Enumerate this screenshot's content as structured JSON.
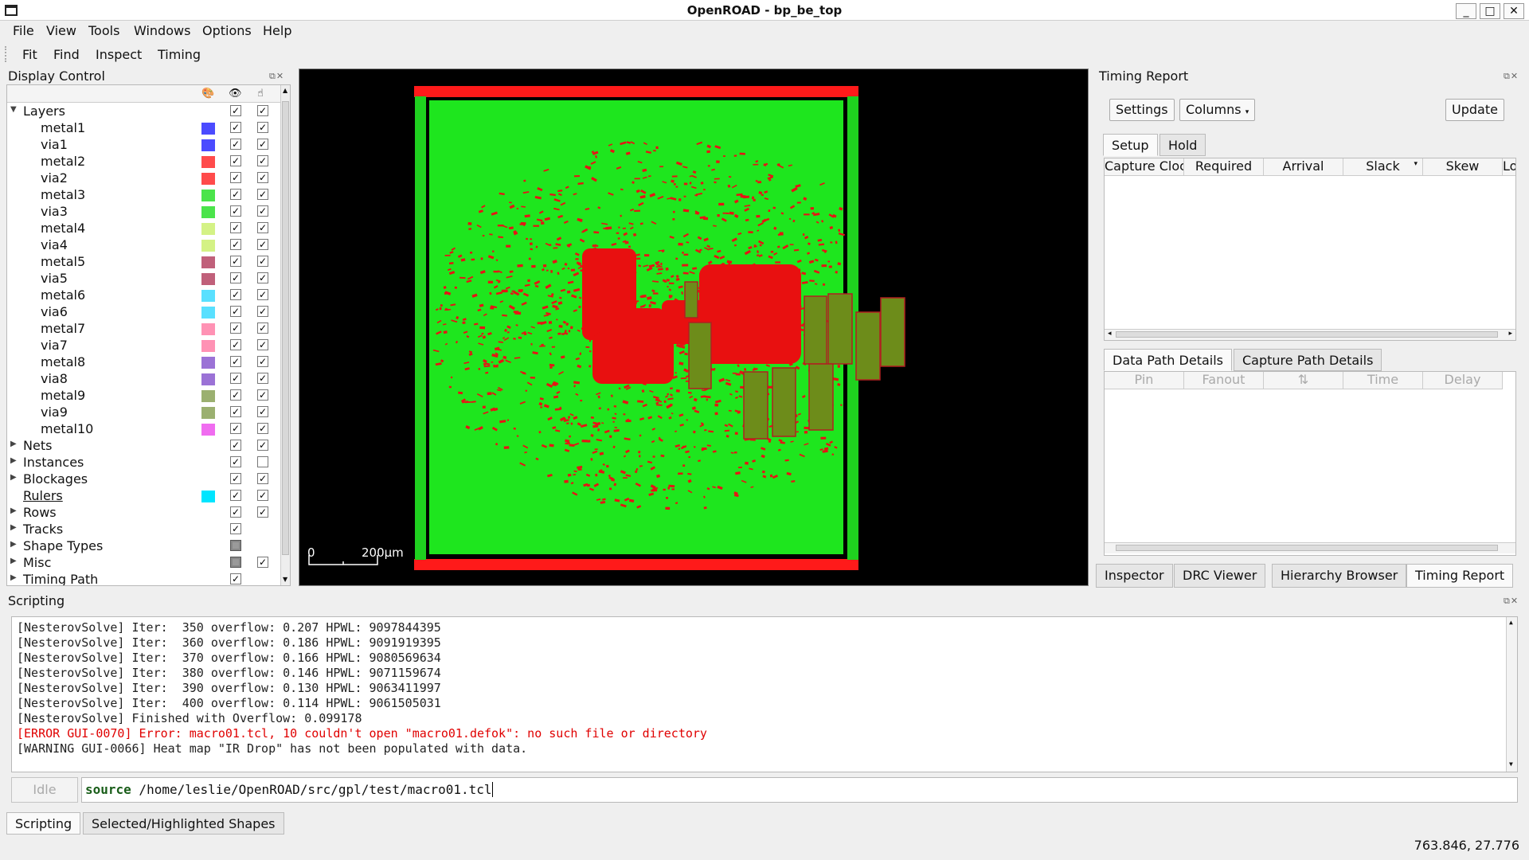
{
  "window": {
    "title": "OpenROAD - bp_be_top"
  },
  "menu": [
    "File",
    "View",
    "Tools",
    "Windows",
    "Options",
    "Help"
  ],
  "toolbar": [
    "Fit",
    "Find",
    "Inspect",
    "Timing"
  ],
  "display_control": {
    "title": "Display Control",
    "layers_label": "Layers",
    "layers": [
      {
        "name": "metal1",
        "color": "#4b4bff"
      },
      {
        "name": "via1",
        "color": "#4b4bff"
      },
      {
        "name": "metal2",
        "color": "#ff4b4b"
      },
      {
        "name": "via2",
        "color": "#ff4b4b"
      },
      {
        "name": "metal3",
        "color": "#4be44b"
      },
      {
        "name": "via3",
        "color": "#4be44b"
      },
      {
        "name": "metal4",
        "color": "#d4f285"
      },
      {
        "name": "via4",
        "color": "#d4f285"
      },
      {
        "name": "metal5",
        "color": "#c0607a"
      },
      {
        "name": "via5",
        "color": "#c0607a"
      },
      {
        "name": "metal6",
        "color": "#59e0ff"
      },
      {
        "name": "via6",
        "color": "#59e0ff"
      },
      {
        "name": "metal7",
        "color": "#ff92b4"
      },
      {
        "name": "via7",
        "color": "#ff92b4"
      },
      {
        "name": "metal8",
        "color": "#9b72d6"
      },
      {
        "name": "via8",
        "color": "#9b72d6"
      },
      {
        "name": "metal9",
        "color": "#9bb070"
      },
      {
        "name": "via9",
        "color": "#9bb070"
      },
      {
        "name": "metal10",
        "color": "#f06cf0"
      }
    ],
    "groups": [
      {
        "name": "Nets",
        "visible": "check",
        "select": "check"
      },
      {
        "name": "Instances",
        "visible": "check",
        "select": "empty"
      },
      {
        "name": "Blockages",
        "visible": "check",
        "select": "check"
      },
      {
        "name": "Rulers",
        "visible": "check",
        "select": "check",
        "color": "#00e5ff",
        "underline": true
      },
      {
        "name": "Rows",
        "visible": "check",
        "select": "check"
      },
      {
        "name": "Tracks",
        "visible": "check",
        "select": "none"
      },
      {
        "name": "Shape Types",
        "visible": "partial",
        "select": "none"
      },
      {
        "name": "Misc",
        "visible": "partial",
        "select": "check"
      },
      {
        "name": "Timing Path",
        "visible": "check",
        "select": "none"
      }
    ]
  },
  "canvas": {
    "scale_start": "0",
    "scale_label": "200µm"
  },
  "timing_report": {
    "title": "Timing Report",
    "settings": "Settings",
    "columns": "Columns",
    "update": "Update",
    "tabs": [
      "Setup",
      "Hold"
    ],
    "headers": [
      "Capture Cloc",
      "Required",
      "Arrival",
      "Slack",
      "Skew",
      "Lo"
    ],
    "detail_tabs": [
      "Data Path Details",
      "Capture Path Details"
    ],
    "detail_headers": [
      "Pin",
      "Fanout",
      "⇅",
      "Time",
      "Delay"
    ]
  },
  "right_tabs": [
    "Inspector",
    "DRC Viewer",
    "Hierarchy Browser",
    "Timing Report"
  ],
  "scripting": {
    "title": "Scripting",
    "lines": [
      {
        "text": "[NesterovSolve] Iter:  350 overflow: 0.207 HPWL: 9097844395",
        "color": "#222"
      },
      {
        "text": "[NesterovSolve] Iter:  360 overflow: 0.186 HPWL: 9091919395",
        "color": "#222"
      },
      {
        "text": "[NesterovSolve] Iter:  370 overflow: 0.166 HPWL: 9080569634",
        "color": "#222"
      },
      {
        "text": "[NesterovSolve] Iter:  380 overflow: 0.146 HPWL: 9071159674",
        "color": "#222"
      },
      {
        "text": "[NesterovSolve] Iter:  390 overflow: 0.130 HPWL: 9063411997",
        "color": "#222"
      },
      {
        "text": "[NesterovSolve] Iter:  400 overflow: 0.114 HPWL: 9061505031",
        "color": "#222"
      },
      {
        "text": "[NesterovSolve] Finished with Overflow: 0.099178",
        "color": "#222"
      },
      {
        "text": "[ERROR GUI-0070] Error: macro01.tcl, 10 couldn't open \"macro01.defok\": no such file or directory",
        "color": "#e00000"
      },
      {
        "text": "[WARNING GUI-0066] Heat map \"IR Drop\" has not been populated with data.",
        "color": "#222"
      }
    ],
    "idle": "Idle",
    "cmd_keyword": "source",
    "cmd_rest": " /home/leslie/OpenROAD/src/gpl/test/macro01.tcl"
  },
  "bottom_tabs": [
    "Scripting",
    "Selected/Highlighted Shapes"
  ],
  "status": "763.846, 27.776"
}
